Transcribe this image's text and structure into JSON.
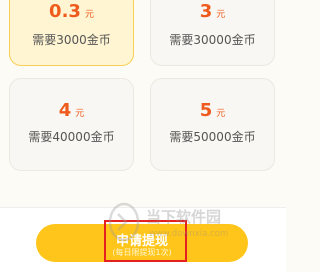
{
  "options": [
    {
      "amount": "0.3",
      "unit": "元",
      "coins": "需要3000金币",
      "selected": true
    },
    {
      "amount": "3",
      "unit": "元",
      "coins": "需要30000金币",
      "selected": false
    },
    {
      "amount": "4",
      "unit": "元",
      "coins": "需要40000金币",
      "selected": false
    },
    {
      "amount": "5",
      "unit": "元",
      "coins": "需要50000金币",
      "selected": false
    }
  ],
  "withdraw_button": {
    "label": "申请提现",
    "sublabel": "(每日限提现1次)"
  },
  "watermark": {
    "name": "当下软件园",
    "url": "www.downxia.com"
  },
  "colors": {
    "accent": "#ee5b1d",
    "button": "#ffc51a",
    "selected_border": "#f7cf55",
    "highlight": "#e52020"
  }
}
